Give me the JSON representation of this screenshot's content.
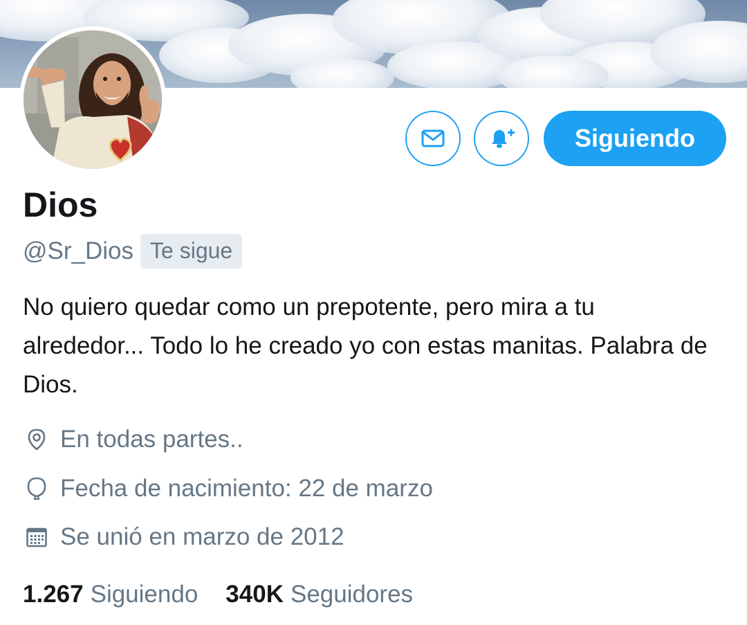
{
  "profile": {
    "name": "Dios",
    "handle": "@Sr_Dios",
    "follows_you_badge": "Te sigue",
    "bio": "No quiero quedar como un prepotente, pero mira a tu alrededor... Todo lo he creado yo con estas manitas. Palabra de Dios.",
    "location": "En todas partes..",
    "birthday": "Fecha de nacimiento: 22 de marzo",
    "joined": "Se unió en marzo de 2012"
  },
  "actions": {
    "message_icon": "envelope-icon",
    "notifications_icon": "bell-plus-icon",
    "follow_label": "Siguiendo"
  },
  "stats": {
    "following_count": "1.267",
    "following_label": "Siguiendo",
    "followers_count": "340K",
    "followers_label": "Seguidores"
  },
  "icons": {
    "location": "location-pin-icon",
    "birthday": "balloon-icon",
    "joined": "calendar-icon"
  },
  "colors": {
    "accent": "#1da1f2",
    "text_primary": "#14171a",
    "text_secondary": "#657786",
    "badge_bg": "#e6ecf0"
  }
}
